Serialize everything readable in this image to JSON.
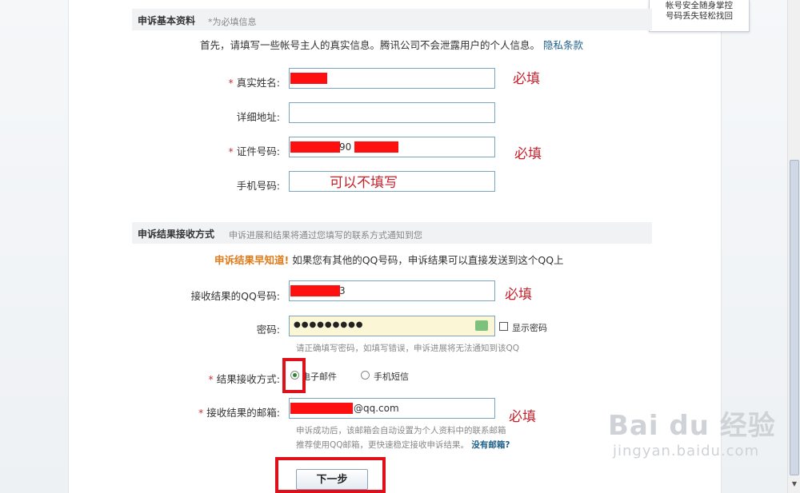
{
  "tip": {
    "line1": "帐号安全随身掌控",
    "line2": "号码丢失轻松找回"
  },
  "basic": {
    "title": "申诉基本资料",
    "note": "*为必填信息",
    "intro": "首先，请填写一些帐号主人的真实信息。腾讯公司不会泄露用户的个人信息。",
    "privacy_link": "隐私条款",
    "fields": {
      "real_name": {
        "label": "真实姓名:",
        "required": "*"
      },
      "address": {
        "label": "详细地址:"
      },
      "id_number": {
        "label": "证件号码:",
        "required": "*",
        "visible_digits": "90"
      },
      "phone": {
        "label": "手机号码:"
      }
    },
    "annotations": {
      "required1": "必填",
      "required2": "必填",
      "optional": "可以不填写"
    }
  },
  "result": {
    "title": "申诉结果接收方式",
    "note": "申诉进展和结果将通过您填写的联系方式通知到您",
    "promo_highlight": "申诉结果早知道!",
    "promo_text": "如果您有其他的QQ号码，申诉结果可以直接发送到这个QQ上",
    "qq": {
      "label": "接收结果的QQ号码:",
      "visible_tail": "3",
      "annotation": "必填"
    },
    "password": {
      "label": "密码:",
      "value": "●●●●●●●●●",
      "show_label": "显示密码",
      "hint": "请正确填写密码，如填写错误，申诉进展将无法通知到该QQ"
    },
    "method": {
      "label": "结果接收方式:",
      "required": "*",
      "option_email": "电子邮件",
      "option_sms": "手机短信"
    },
    "email": {
      "label": "接收结果的邮箱:",
      "required": "*",
      "visible_tail": "@qq.com",
      "annotation": "必填",
      "hint1": "申诉成功后，该邮箱会自动设置为个人资料中的联系邮箱",
      "hint2": "推荐使用QQ邮箱，更快速稳定接收申诉结果。",
      "no_email_link": "没有邮箱?"
    },
    "next_button": "下一步"
  },
  "watermark": {
    "main": "Bai du 经验",
    "sub": "jingyan.baidu.com"
  },
  "colors": {
    "annotation": "#c8202a",
    "highlight": "#e07b1a",
    "link": "#1d5f8a",
    "redact": "#ff1010"
  }
}
